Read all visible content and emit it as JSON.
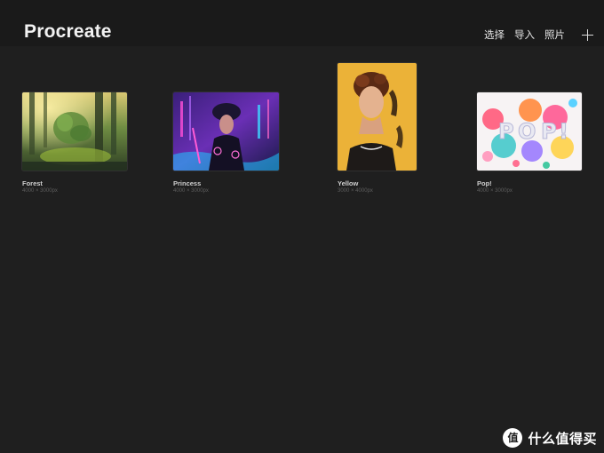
{
  "header": {
    "title": "Procreate",
    "actions": {
      "select": "选择",
      "import": "导入",
      "photo": "照片"
    },
    "add_icon": "plus-icon"
  },
  "gallery": {
    "items": [
      {
        "name": "Forest",
        "size": "4000 × 3000px"
      },
      {
        "name": "Princess",
        "size": "4000 × 3000px"
      },
      {
        "name": "Yellow",
        "size": "3000 × 4000px"
      },
      {
        "name": "Pop!",
        "size": "4000 × 3000px"
      }
    ]
  },
  "watermark": {
    "icon": "value-icon",
    "icon_glyph": "值",
    "text": "什么值得买"
  }
}
